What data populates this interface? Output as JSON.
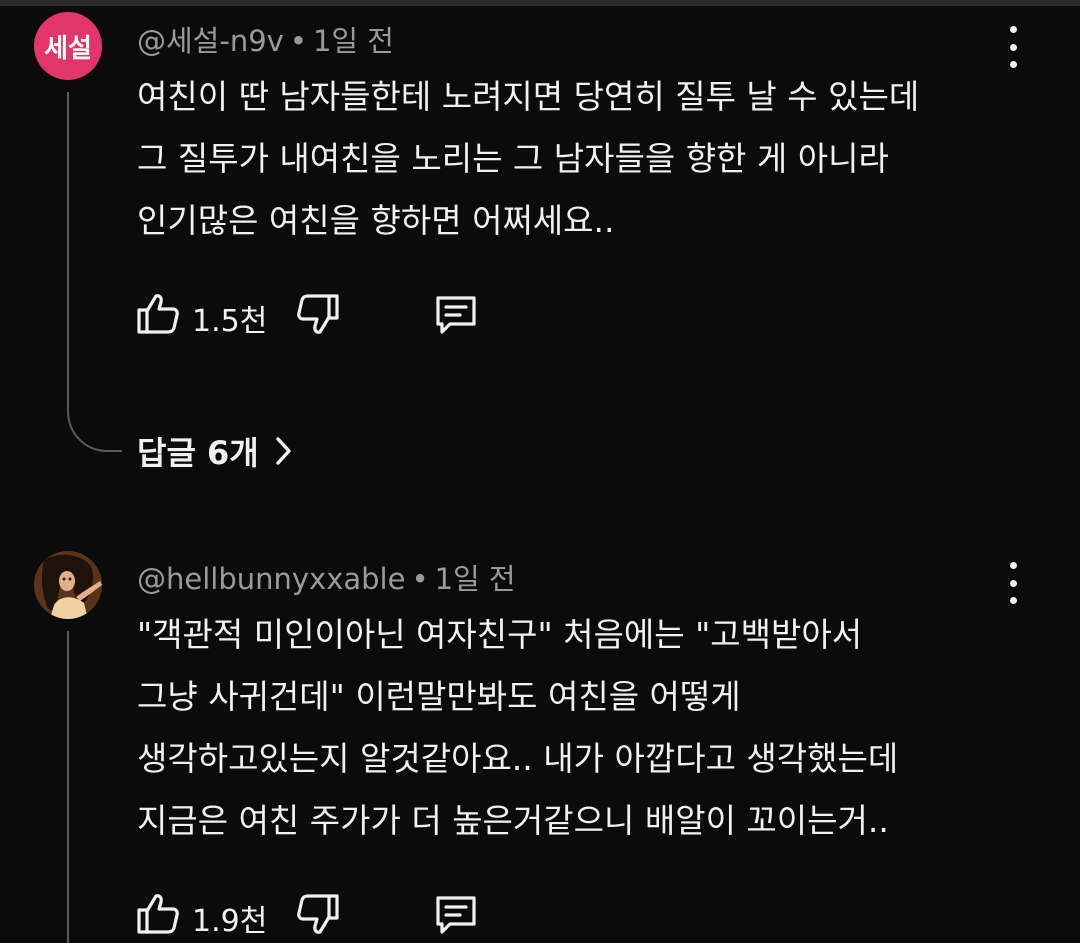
{
  "comments": [
    {
      "avatar_text": "세설",
      "avatar_color": "#e1356c",
      "author": "@세설-n9v",
      "time": "1일 전",
      "lines": [
        "여친이 딴 남자들한테 노려지면 당연히 질투 날 수 있는데",
        "그 질투가 내여친을 노리는 그 남자들을 향한 게 아니라",
        "인기많은 여친을 향하면 어쩌세요.."
      ],
      "like_count": "1.5천",
      "replies_label": "답글 6개"
    },
    {
      "avatar_text": "",
      "author": "@hellbunnyxxable",
      "time": "1일 전",
      "lines": [
        "\"객관적 미인이아닌 여자친구\" 처음에는 \"고백받아서",
        "그냥 사귀건데\" 이런말만봐도 여친을 어떻게",
        "생각하고있는지 알것같아요.. 내가 아깝다고 생각했는데",
        "지금은 여친 주가가 더 높은거같으니 배알이 꼬이는거.."
      ],
      "like_count": "1.9천"
    }
  ],
  "meta_separator": "•",
  "icons": {
    "like": "thumbs-up-icon",
    "dislike": "thumbs-down-icon",
    "reply": "comment-icon",
    "more": "more-vert-icon",
    "chevron": "chevron-right-icon"
  }
}
